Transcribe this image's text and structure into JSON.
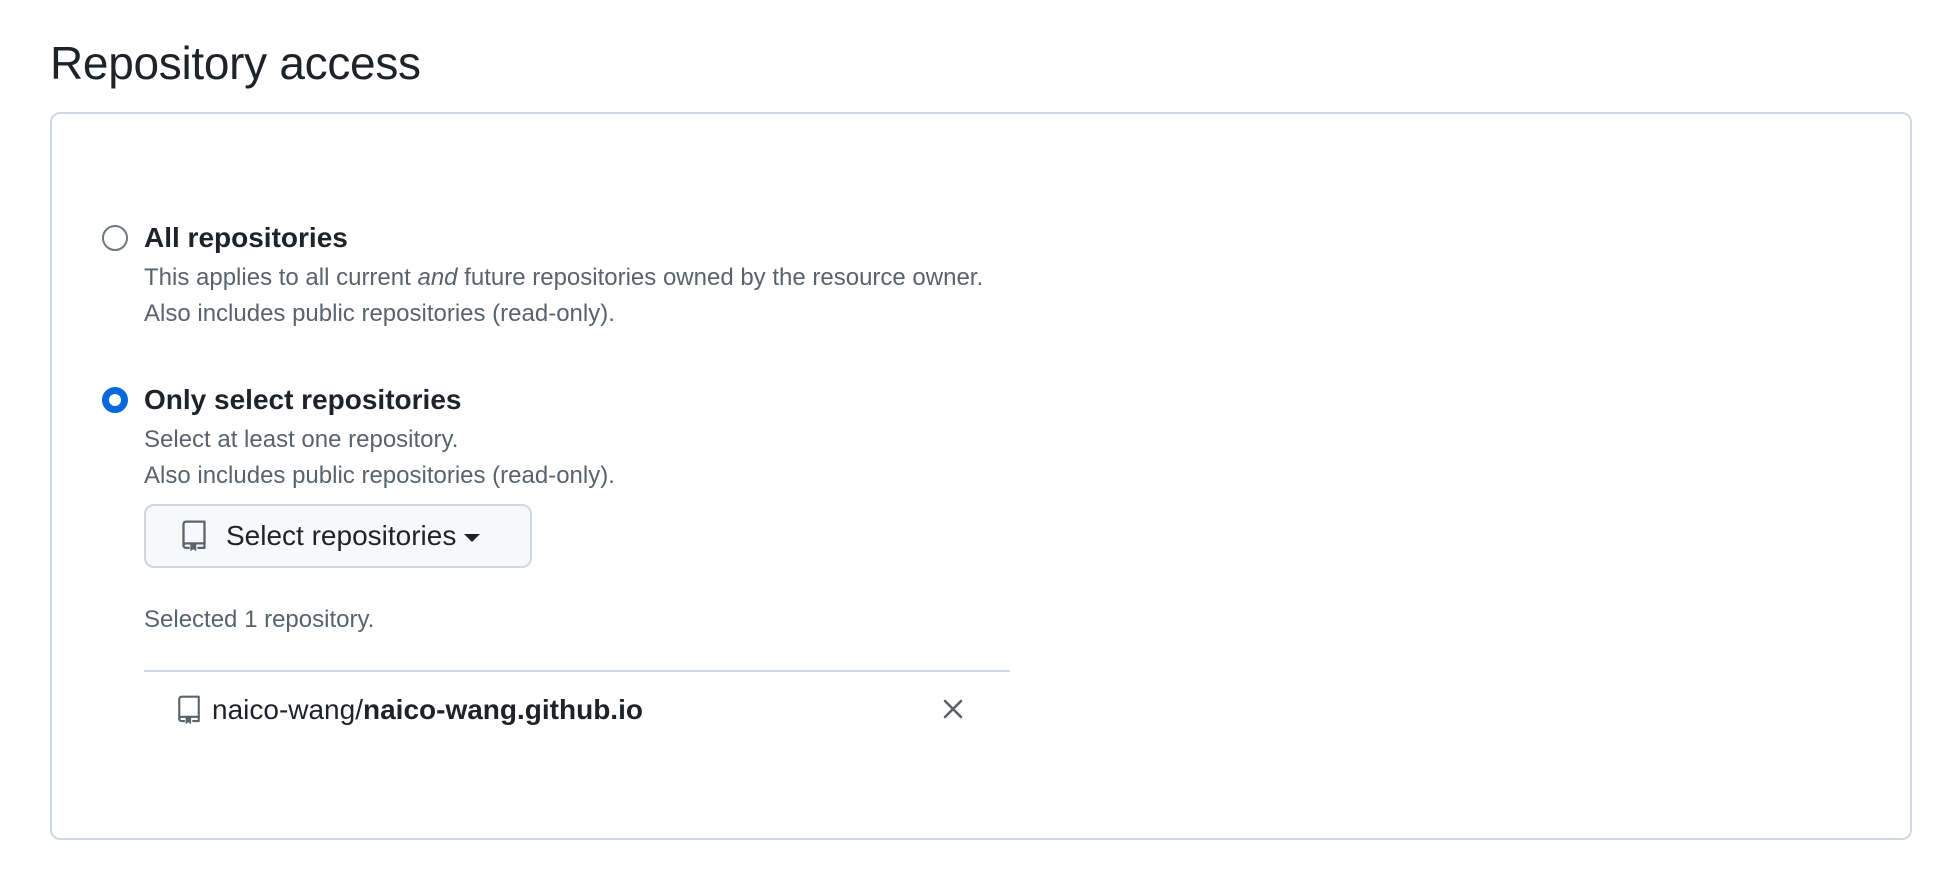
{
  "page": {
    "title": "Repository access"
  },
  "options": {
    "all": {
      "label": "All repositories",
      "checked": false,
      "desc_line1_before": "This applies to all current ",
      "desc_line1_emphasis": "and",
      "desc_line1_after": " future repositories owned by the resource owner.",
      "desc_line2": "Also includes public repositories (read-only)."
    },
    "select": {
      "label": "Only select repositories",
      "checked": true,
      "desc_line1": "Select at least one repository.",
      "desc_line2": "Also includes public repositories (read-only)."
    }
  },
  "select_button": {
    "label": "Select repositories",
    "icon": "repo-icon",
    "caret_icon": "triangle-down-icon"
  },
  "selected": {
    "count_text": "Selected 1 repository.",
    "repos": [
      {
        "owner": "naico-wang/",
        "name": "naico-wang.github.io",
        "icon": "repo-icon",
        "remove_icon": "x-icon"
      }
    ]
  },
  "colors": {
    "accent": "#0969da",
    "text": "#1f2328",
    "muted": "#59636e",
    "border": "#d0d7de",
    "button_bg": "#f6f8fa"
  }
}
